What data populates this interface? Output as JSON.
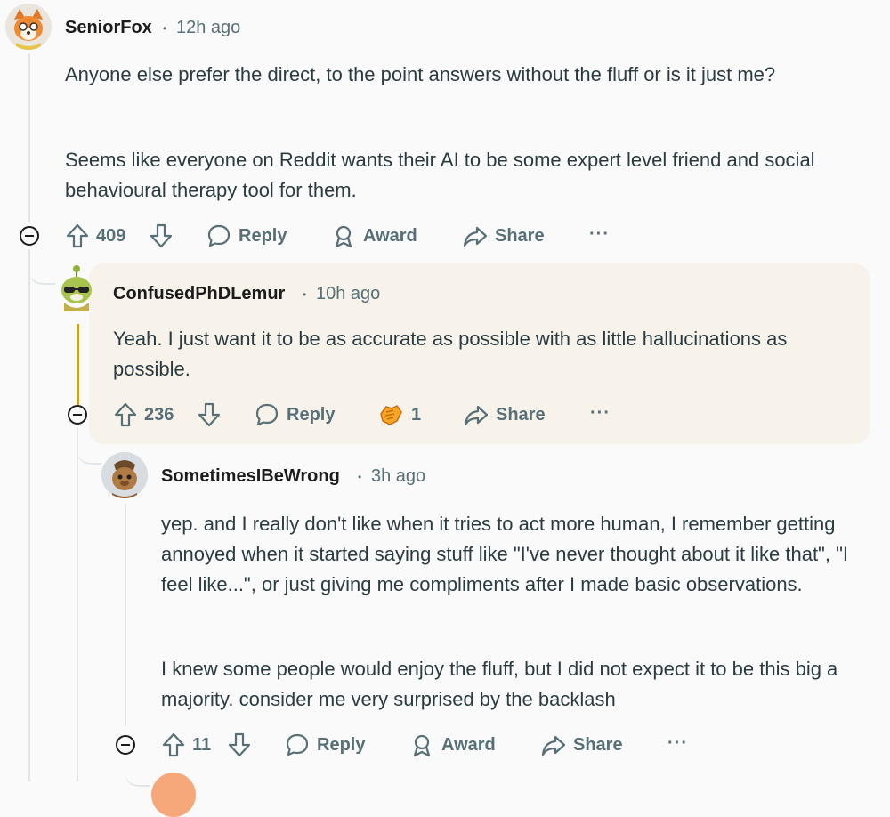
{
  "comments": [
    {
      "username": "SeniorFox",
      "time": "12h ago",
      "body": [
        "Anyone else prefer the direct, to the point answers without the fluff or is it just me?",
        "Seems like everyone on Reddit wants their AI to be some expert level friend and social behavioural therapy tool for them."
      ],
      "votes": "409",
      "reply_label": "Reply",
      "award_label": "Award",
      "share_label": "Share",
      "more_label": "···"
    },
    {
      "username": "ConfusedPhDLemur",
      "time": "10h ago",
      "body": [
        "Yeah. I just want it to be as accurate as possible with as little hallucinations as possible."
      ],
      "votes": "236",
      "reply_label": "Reply",
      "award_count": "1",
      "share_label": "Share",
      "more_label": "···"
    },
    {
      "username": "SometimesIBeWrong",
      "time": "3h ago",
      "body": [
        "yep. and I really don't like when it tries to act more human, I remember getting annoyed when it started saying stuff like \"I've never thought about it like that\", \"I feel like...\", or just giving me compliments after I made basic observations.",
        "I knew some people would enjoy the fluff, but I did not expect it to be this big a majority. consider me very surprised by the backlash"
      ],
      "votes": "11",
      "reply_label": "Reply",
      "award_label": "Award",
      "share_label": "Share",
      "more_label": "···"
    }
  ],
  "separator": "•",
  "icons": [
    "upvote-icon",
    "downvote-icon",
    "reply-bubble-icon",
    "award-icon",
    "share-arrow-icon",
    "collapse-icon",
    "award-hands-icon"
  ],
  "colors": {
    "highlight": "#f7f3eb",
    "gold_line": "#c9a227",
    "meta": "#576f76"
  }
}
